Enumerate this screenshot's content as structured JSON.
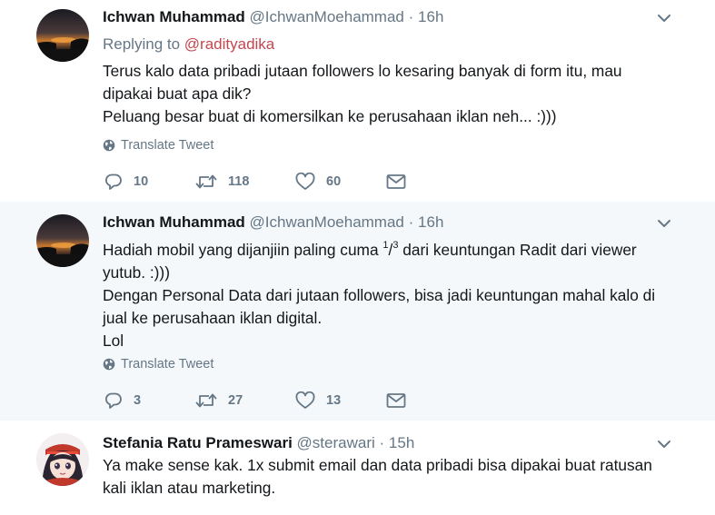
{
  "tweets": [
    {
      "name": "Ichwan Muhammad",
      "handle": "@IchwanMoehammad",
      "separator": "·",
      "time": "16h",
      "replying_prefix": "Replying to",
      "replying_to": "@radityadika",
      "lines": [
        "Terus kalo data pribadi jutaan followers lo kesaring banyak di form itu, mau",
        "dipakai buat apa dik?",
        "Peluang besar buat di komersilkan ke perusahaan iklan neh... :)))"
      ],
      "translate": "Translate Tweet",
      "replies": "10",
      "retweets": "118",
      "likes": "60"
    },
    {
      "name": "Ichwan Muhammad",
      "handle": "@IchwanMoehammad",
      "separator": "·",
      "time": "16h",
      "line1_pre": "Hadiah mobil yang dijanjiin paling cuma ",
      "frac_num": "1",
      "frac_slash": "/",
      "frac_den": "3",
      "line1_post": " dari keuntungan Radit dari viewer",
      "lines": [
        "yutub. :)))",
        "Dengan Personal Data dari jutaan followers, bisa jadi keuntungan mahal kalo di",
        "jual ke perusahaan iklan digital.",
        "Lol"
      ],
      "translate": "Translate Tweet",
      "replies": "3",
      "retweets": "27",
      "likes": "13"
    },
    {
      "name": "Stefania Ratu Prameswari",
      "handle": "@sterawari",
      "separator": "·",
      "time": "15h",
      "lines": [
        "Ya make sense kak. 1x submit email dan data pribadi bisa dipakai buat ratusan",
        "kali iklan atau marketing."
      ]
    }
  ],
  "icons": {
    "reply": "reply-icon",
    "retweet": "retweet-icon",
    "like": "heart-icon",
    "dm": "envelope-icon",
    "globe": "globe-icon",
    "caret": "chevron-down-icon"
  },
  "colors": {
    "thread_line": "#d7a2a4",
    "mention": "#c2474f",
    "secondary_text": "#657786",
    "highlight_bg": "#f5f8fa"
  }
}
